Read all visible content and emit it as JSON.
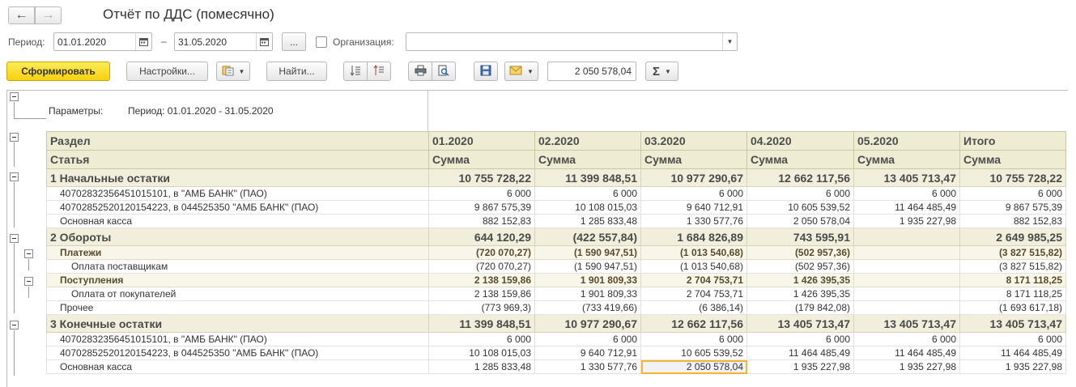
{
  "window": {
    "title": "Отчёт по ДДС (помесячно)",
    "back_icon": "←",
    "forward_icon": "→"
  },
  "period": {
    "label": "Период:",
    "from": "01.01.2020",
    "dash": "–",
    "to": "31.05.2020",
    "more_label": "...",
    "org_label": "Организация:",
    "org_value": ""
  },
  "toolbar": {
    "generate_label": "Сформировать",
    "settings_label": "Настройки...",
    "find_label": "Найти...",
    "sum_value": "2 050 578,04",
    "sigma_label": "Σ"
  },
  "report": {
    "params_label": "Параметры:",
    "params_value": "Период: 01.01.2020 - 31.05.2020",
    "header1": [
      "Раздел",
      "01.2020",
      "02.2020",
      "03.2020",
      "04.2020",
      "05.2020",
      "Итого"
    ],
    "header2": [
      "Статья",
      "Сумма",
      "Сумма",
      "Сумма",
      "Сумма",
      "Сумма",
      "Сумма"
    ],
    "rows": [
      {
        "type": "sec",
        "name": "1 Начальные остатки",
        "values": [
          "10 755 728,22",
          "11 399 848,51",
          "10 977 290,67",
          "12 662 117,56",
          "13 405 713,47",
          "10 755 728,22"
        ]
      },
      {
        "type": "d",
        "indent": 1,
        "name": "40702832356451015101, в \"АМБ БАНК\" (ПАО)",
        "values": [
          "6 000",
          "6 000",
          "6 000",
          "6 000",
          "6 000",
          "6 000"
        ]
      },
      {
        "type": "d",
        "indent": 1,
        "name": "40702852520120154223, в 044525350 \"АМБ БАНК\" (ПАО)",
        "values": [
          "9 867 575,39",
          "10 108 015,03",
          "9 640 712,91",
          "10 605 539,52",
          "11 464 485,49",
          "9 867 575,39"
        ]
      },
      {
        "type": "d",
        "indent": 1,
        "name": "Основная касса",
        "values": [
          "882 152,83",
          "1 285 833,48",
          "1 330 577,76",
          "2 050 578,04",
          "1 935 227,98",
          "882 152,83"
        ]
      },
      {
        "type": "sec",
        "name": "2 Обороты",
        "values": [
          "644 120,29",
          "(422 557,84)",
          "1 684 826,89",
          "743 595,91",
          "",
          "2 649 985,25"
        ]
      },
      {
        "type": "sub",
        "indent": 1,
        "name": "Платежи",
        "values": [
          "(720 070,27)",
          "(1 590 947,51)",
          "(1 013 540,68)",
          "(502 957,36)",
          "",
          "(3 827 515,82)"
        ]
      },
      {
        "type": "d",
        "indent": 2,
        "name": "Оплата поставщикам",
        "values": [
          "(720 070,27)",
          "(1 590 947,51)",
          "(1 013 540,68)",
          "(502 957,36)",
          "",
          "(3 827 515,82)"
        ]
      },
      {
        "type": "sub",
        "indent": 1,
        "name": "Поступления",
        "values": [
          "2 138 159,86",
          "1 901 809,33",
          "2 704 753,71",
          "1 426 395,35",
          "",
          "8 171 118,25"
        ]
      },
      {
        "type": "d",
        "indent": 2,
        "name": "Оплата от покупателей",
        "values": [
          "2 138 159,86",
          "1 901 809,33",
          "2 704 753,71",
          "1 426 395,35",
          "",
          "8 171 118,25"
        ]
      },
      {
        "type": "d",
        "indent": 1,
        "name": "Прочее",
        "values": [
          "(773 969,3)",
          "(733 419,66)",
          "(6 386,14)",
          "(179 842,08)",
          "",
          "(1 693 617,18)"
        ]
      },
      {
        "type": "sec",
        "name": "3 Конечные остатки",
        "values": [
          "11 399 848,51",
          "10 977 290,67",
          "12 662 117,56",
          "13 405 713,47",
          "13 405 713,47",
          "13 405 713,47"
        ]
      },
      {
        "type": "d",
        "indent": 1,
        "name": "40702832356451015101, в \"АМБ БАНК\" (ПАО)",
        "values": [
          "6 000",
          "6 000",
          "6 000",
          "6 000",
          "6 000",
          "6 000"
        ]
      },
      {
        "type": "d",
        "indent": 1,
        "name": "40702852520120154223, в 044525350 \"АМБ БАНК\" (ПАО)",
        "values": [
          "10 108 015,03",
          "9 640 712,91",
          "10 605 539,52",
          "11 464 485,49",
          "11 464 485,49",
          "11 464 485,49"
        ]
      },
      {
        "type": "d",
        "indent": 1,
        "name": "Основная касса",
        "values": [
          "1 285 833,48",
          "1 330 577,76",
          "2 050 578,04",
          "1 935 227,98",
          "1 935 227,98",
          "1 935 227,98"
        ],
        "selected_col": 2
      }
    ]
  }
}
